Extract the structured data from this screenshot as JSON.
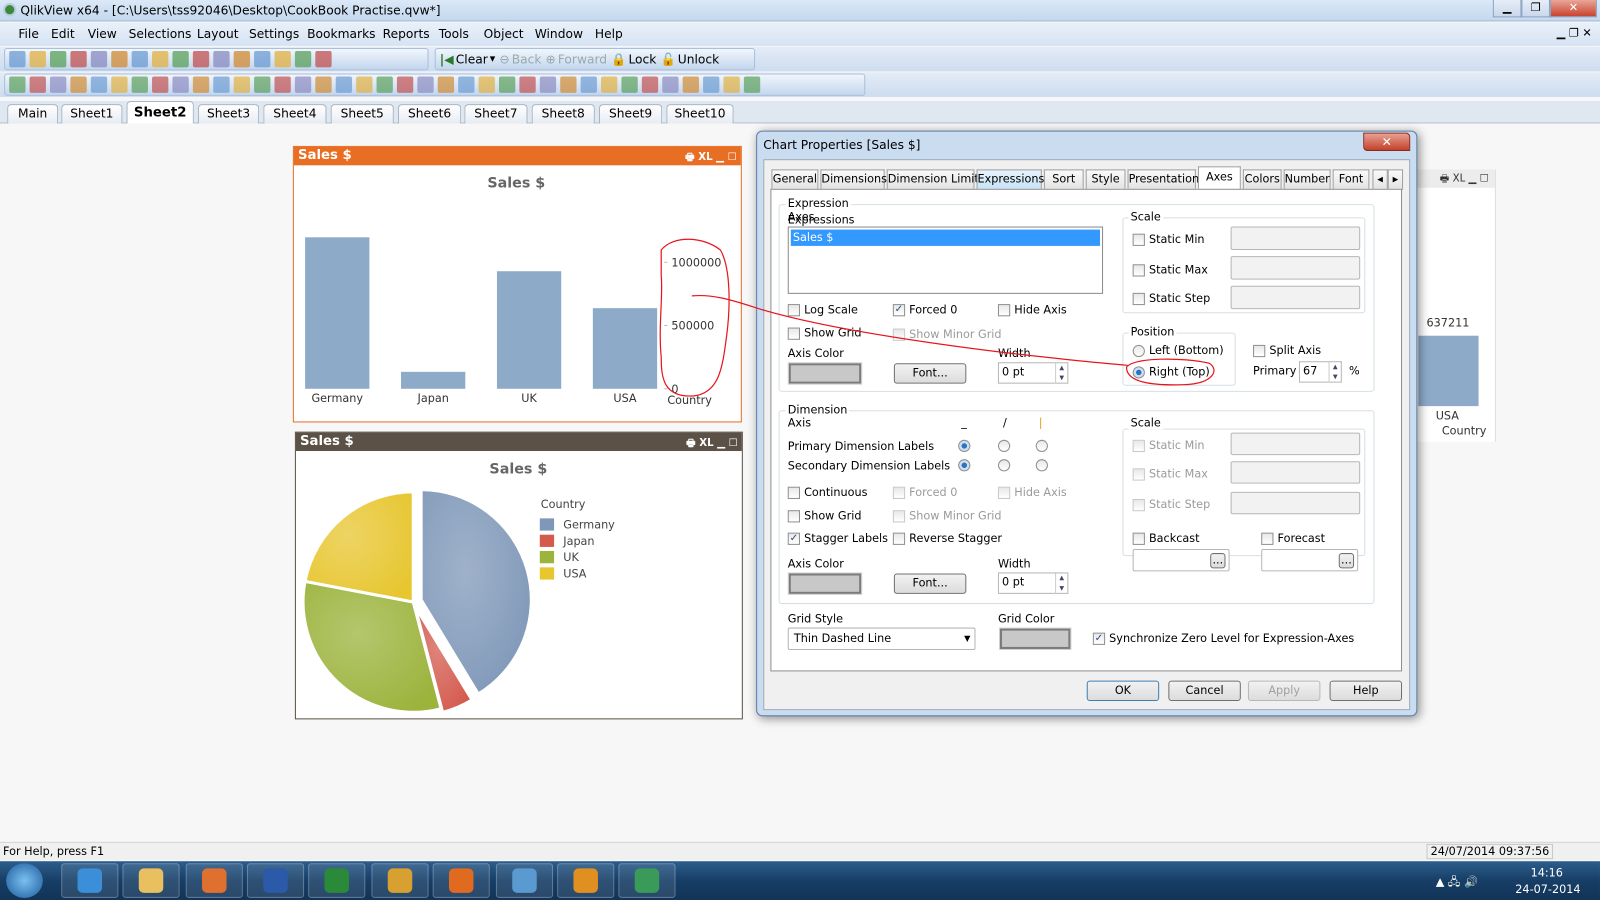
{
  "window": {
    "title": "QlikView x64 - [C:\\Users\\tss92046\\Desktop\\CookBook Practise.qvw*]",
    "min": "▁",
    "max": "❐",
    "close": "✕",
    "mdi_controls": "▁ ❐ ✕"
  },
  "menu": [
    "File",
    "Edit",
    "View",
    "Selections",
    "Layout",
    "Settings",
    "Bookmarks",
    "Reports",
    "Tools",
    "Object",
    "Window",
    "Help"
  ],
  "toolbar1": {
    "icons": [
      "new-icon",
      "open-icon",
      "reload-icon",
      "save-icon",
      "print-icon",
      "edit-script-icon",
      "reload-data-icon",
      "undo-icon",
      "redo-icon",
      "search-icon",
      "current-selections-icon",
      "chart-wizard-icon",
      "bookmark-star-icon",
      "edit-icon",
      "help-icon",
      "whats-this-icon"
    ],
    "clear": "Clear",
    "back": "Back",
    "forward": "Forward",
    "lock": "Lock",
    "unlock": "Unlock"
  },
  "toolbar2": {
    "icons": [
      "new-sheet-icon",
      "sheet-left-icon",
      "sheet-right-icon",
      "sheet-props-icon",
      "listbox-icon",
      "statistics-box-icon",
      "multibox-icon",
      "table-box-icon",
      "chart-icon",
      "input-box-icon",
      "current-selections-box-icon",
      "button-icon",
      "text-object-icon",
      "line-arrow-icon",
      "slider-icon",
      "bookmark-object-icon",
      "search-object-icon",
      "container-icon",
      "custom-object-icon",
      "chart-wizard-icon",
      "format-painter-icon",
      "snap-icon",
      "align-left-icon",
      "align-center-icon",
      "align-right-icon",
      "align-bottom-icon",
      "align-middle-icon",
      "align-top-icon",
      "space-h-icon",
      "space-v-icon",
      "adjust-left-icon",
      "adjust-top-icon",
      "user-icon",
      "server-icon",
      "notes-icon",
      "share-icon",
      "web-icon"
    ]
  },
  "sheets": [
    "Main",
    "Sheet1",
    "Sheet2",
    "Sheet3",
    "Sheet4",
    "Sheet5",
    "Sheet6",
    "Sheet7",
    "Sheet8",
    "Sheet9",
    "Sheet10"
  ],
  "active_sheet": "Sheet2",
  "bar_object": {
    "caption": "Sales $",
    "header_color": "#e86e24",
    "icons": "🖶 XL ▁ ☐"
  },
  "pie_object": {
    "caption": "Sales $",
    "header_color": "#5b5146",
    "icons": "🖶 XL ▁ ☐"
  },
  "chart_data": [
    {
      "type": "bar",
      "title": "Sales $",
      "xlabel": "Country",
      "categories": [
        "Germany",
        "Japan",
        "UK",
        "USA"
      ],
      "values": [
        1197000,
        134000,
        929000,
        637211
      ],
      "ylim": [
        0,
        1200000
      ],
      "yticks": [
        "0",
        "500000",
        "1000000"
      ],
      "ytick_values": [
        0,
        500000,
        1000000
      ],
      "axis_position": "right",
      "color": "#8eaac9"
    },
    {
      "type": "pie",
      "title": "Sales $",
      "legend_title": "Country",
      "categories": [
        "Germany",
        "Japan",
        "UK",
        "USA"
      ],
      "values": [
        1197000,
        134000,
        929000,
        637211
      ],
      "colors": [
        "#7f98b8",
        "#d45a4e",
        "#9cb33c",
        "#e7c630"
      ],
      "legend_position": "right"
    }
  ],
  "bg_object": {
    "value_label": "637211",
    "category": "USA",
    "xlabel": "Country",
    "icons": "🖶 XL ▁ ☐"
  },
  "dialog": {
    "title": "Chart Properties [Sales $]",
    "close": "✕",
    "tabs": [
      "General",
      "Dimensions",
      "Dimension Limits",
      "Expressions",
      "Sort",
      "Style",
      "Presentation",
      "Axes",
      "Colors",
      "Number",
      "Font"
    ],
    "active_tab": "Axes",
    "tab_scroll": [
      "◂",
      "▸"
    ],
    "expr": {
      "group": "Expression Axes",
      "list_label": "Expressions",
      "items": [
        "Sales $"
      ],
      "log_scale": {
        "label": "Log Scale",
        "checked": false
      },
      "forced0": {
        "label": "Forced 0",
        "checked": true
      },
      "hide_axis": {
        "label": "Hide Axis",
        "checked": false
      },
      "show_grid": {
        "label": "Show Grid",
        "checked": false
      },
      "show_minor_grid": {
        "label": "Show Minor Grid",
        "checked": false
      },
      "axis_color_label": "Axis Color",
      "axis_color": "#c8c8c8",
      "font_btn": "Font...",
      "width_label": "Width",
      "width": "0 pt",
      "scale": {
        "title": "Scale",
        "min": "Static Min",
        "max": "Static Max",
        "step": "Static Step"
      },
      "position": {
        "title": "Position",
        "left": "Left (Bottom)",
        "right": "Right (Top)",
        "selected": "Right (Top)"
      },
      "split_axis": {
        "label": "Split Axis",
        "checked": false
      },
      "primary_label": "Primary",
      "primary": "67",
      "pct": "%"
    },
    "dim": {
      "group": "Dimension Axis",
      "col_headers": [
        "_",
        "/",
        "|"
      ],
      "primary_labels": "Primary Dimension Labels",
      "secondary_labels": "Secondary Dimension Labels",
      "primary_sel": 0,
      "secondary_sel": 0,
      "continuous": {
        "label": "Continuous",
        "checked": false
      },
      "forced0": {
        "label": "Forced 0",
        "checked": false
      },
      "hide_axis": {
        "label": "Hide Axis",
        "checked": false
      },
      "show_grid": {
        "label": "Show Grid",
        "checked": false
      },
      "show_minor_grid": {
        "label": "Show Minor Grid",
        "checked": false
      },
      "stagger": {
        "label": "Stagger Labels",
        "checked": true
      },
      "reverse_stagger": {
        "label": "Reverse Stagger",
        "checked": false
      },
      "axis_color_label": "Axis Color",
      "font_btn": "Font...",
      "width_label": "Width",
      "width": "0 pt",
      "scale": {
        "title": "Scale",
        "min": "Static Min",
        "max": "Static Max",
        "step": "Static Step"
      },
      "backcast": {
        "label": "Backcast",
        "checked": false
      },
      "forecast": {
        "label": "Forecast",
        "checked": false
      },
      "ellipsis": "..."
    },
    "grid_style_label": "Grid Style",
    "grid_style": "Thin Dashed Line",
    "grid_color_label": "Grid Color",
    "sync_zero": {
      "label": "Synchronize Zero Level for Expression-Axes",
      "checked": true
    },
    "buttons": {
      "ok": "OK",
      "cancel": "Cancel",
      "apply": "Apply",
      "help": "Help"
    }
  },
  "status": {
    "help": "For Help, press F1",
    "datetime": "24/07/2014 09:37:56"
  },
  "taskbar": {
    "apps": [
      "internet-explorer-icon",
      "file-explorer-icon",
      "media-player-icon",
      "word-icon",
      "excel-icon",
      "chrome-icon",
      "firefox-icon",
      "remote-desktop-icon",
      "outlook-icon",
      "qlikview-icon"
    ],
    "time": "14:16",
    "date": "24-07-2014"
  },
  "annotation_color": "#e8141c"
}
